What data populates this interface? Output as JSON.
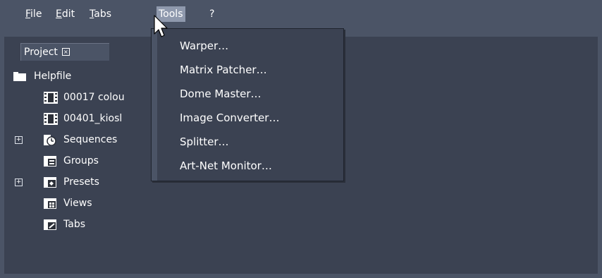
{
  "menubar": {
    "items": [
      {
        "label": "File",
        "mnemonic": "F",
        "rest": "ile"
      },
      {
        "label": "Edit",
        "mnemonic": "E",
        "rest": "dit"
      },
      {
        "label": "Tabs",
        "mnemonic": "T",
        "rest": "abs"
      },
      {
        "label": "Tools",
        "mnemonic": "",
        "rest": "Tools"
      },
      {
        "label": "?",
        "mnemonic": "",
        "rest": "?"
      }
    ],
    "active_item": "Tools"
  },
  "panel": {
    "tab_label": "Project",
    "close_glyph": "×"
  },
  "tree": {
    "items": [
      {
        "label": "Helpfile",
        "icon": "folder-icon"
      },
      {
        "label": "00017 colou",
        "icon": "film-icon"
      },
      {
        "label": "00401_kiosl",
        "icon": "film-icon"
      },
      {
        "label": "Sequences",
        "icon": "sequences-icon",
        "expandable": true
      },
      {
        "label": "Groups",
        "icon": "groups-icon"
      },
      {
        "label": "Presets",
        "icon": "presets-icon",
        "expandable": true
      },
      {
        "label": "Views",
        "icon": "views-icon"
      },
      {
        "label": "Tabs",
        "icon": "tabs-icon"
      }
    ],
    "expander_glyph": "+"
  },
  "tools_menu": {
    "items": [
      {
        "label": "Warper…"
      },
      {
        "label": "Matrix Patcher…"
      },
      {
        "label": "Dome Master…"
      },
      {
        "label": "Image Converter…"
      },
      {
        "label": "Splitter…"
      },
      {
        "label": "Art-Net Monitor…"
      }
    ]
  },
  "colors": {
    "background": "#4b5466",
    "workspace": "#3b4252",
    "menu_highlight": "#8f99ad",
    "text": "#ffffff"
  }
}
